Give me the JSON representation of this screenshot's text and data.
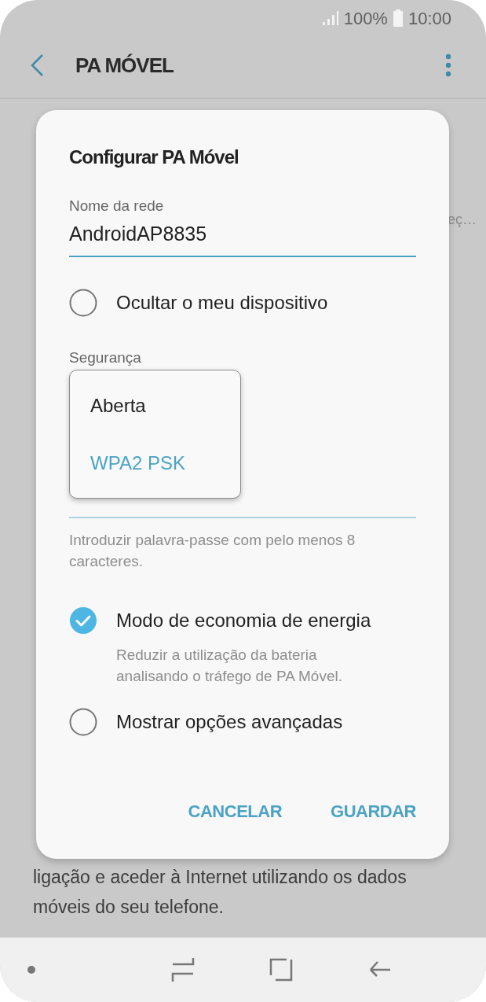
{
  "status_bar": {
    "battery": "100%",
    "time": "10:00"
  },
  "header": {
    "title": "PA MÓVEL"
  },
  "background": {
    "truncated_text": "eç…",
    "paragraph_lines": [
      "ligação e aceder à Internet utilizando os dados",
      "móveis do seu telefone."
    ]
  },
  "dialog": {
    "title": "Configurar PA Móvel",
    "network_name": {
      "label": "Nome da rede",
      "value": "AndroidAP8835"
    },
    "hide_device": {
      "label": "Ocultar o meu dispositivo",
      "checked": false
    },
    "security": {
      "label": "Segurança",
      "options": [
        {
          "label": "Aberta",
          "selected": false
        },
        {
          "label": "WPA2 PSK",
          "selected": true
        }
      ]
    },
    "password_hint": "Introduzir palavra-passe com pelo menos 8 caracteres.",
    "power_saving": {
      "label": "Modo de economia de energia",
      "description": "Reduzir a utilização da bateria analisando o tráfego de PA Móvel.",
      "checked": true
    },
    "advanced": {
      "label": "Mostrar opções avançadas",
      "checked": false
    },
    "buttons": [
      "CANCELAR",
      "GUARDAR"
    ]
  }
}
